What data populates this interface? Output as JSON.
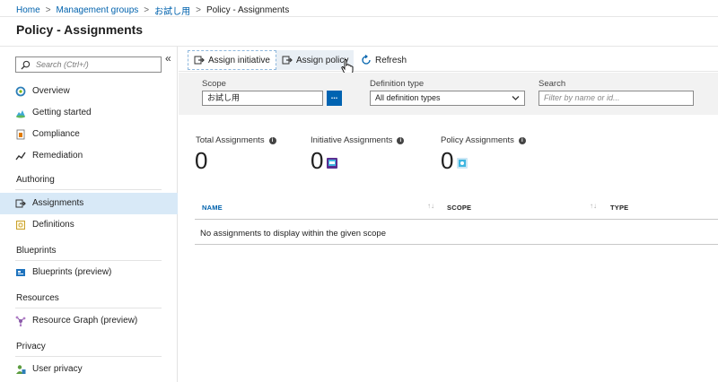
{
  "breadcrumb": {
    "home": "Home",
    "management_groups": "Management groups",
    "group": "お試し用",
    "current": "Policy - Assignments",
    "separator": ">"
  },
  "page_title": "Policy - Assignments",
  "sidebar": {
    "search_placeholder": "Search (Ctrl+/)",
    "collapse": "«",
    "items": [
      {
        "label": "Overview",
        "icon": "overview-icon"
      },
      {
        "label": "Getting started",
        "icon": "cloud-icon"
      },
      {
        "label": "Compliance",
        "icon": "compliance-icon"
      },
      {
        "label": "Remediation",
        "icon": "remediation-icon"
      },
      {
        "label": "Assignments",
        "icon": "assignments-icon",
        "active": true
      },
      {
        "label": "Definitions",
        "icon": "definitions-icon"
      },
      {
        "label": "Blueprints (preview)",
        "icon": "blueprints-icon"
      },
      {
        "label": "Resource Graph (preview)",
        "icon": "resource-graph-icon"
      },
      {
        "label": "User privacy",
        "icon": "user-privacy-icon"
      }
    ],
    "sections": {
      "authoring": "Authoring",
      "blueprints": "Blueprints",
      "resources": "Resources",
      "privacy": "Privacy"
    }
  },
  "toolbar": {
    "assign_initiative": "Assign initiative",
    "assign_policy": "Assign policy",
    "refresh": "Refresh"
  },
  "filters": {
    "scope_label": "Scope",
    "scope_value": "お試し用",
    "scope_button": "...",
    "definition_type_label": "Definition type",
    "definition_type_value": "All definition types",
    "search_label": "Search",
    "search_placeholder": "Filter by name or id..."
  },
  "stats": {
    "total_label": "Total Assignments",
    "total_value": "0",
    "initiative_label": "Initiative Assignments",
    "initiative_value": "0",
    "policy_label": "Policy Assignments",
    "policy_value": "0",
    "info": "i"
  },
  "table": {
    "columns": [
      "NAME",
      "SCOPE",
      "TYPE"
    ],
    "sort_glyph": "↑↓",
    "empty_message": "No assignments to display within the given scope"
  },
  "colors": {
    "link": "#0062ad",
    "accent": "#0063b1",
    "active_nav": "#d8e9f7"
  }
}
